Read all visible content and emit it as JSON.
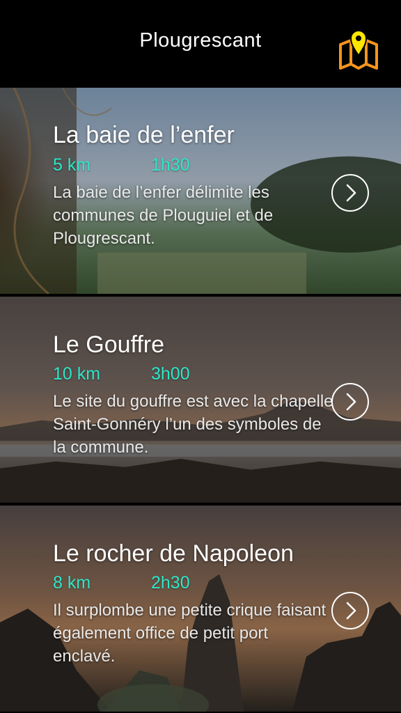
{
  "status_bar": {
    "battery_color": "#4cd964"
  },
  "header": {
    "title": "Plougrescant",
    "map_icon": "map-pin-icon",
    "map_icon_color": "#f7941d",
    "map_pin_color": "#ffe600"
  },
  "accent_color": "#2ee6c9",
  "walks": [
    {
      "title": "La baie de l’enfer",
      "distance": "5 km",
      "duration": "1h30",
      "description": "La baie de l’enfer délimite les communes de Plouguiel et de Plougrescant.",
      "action_icon": "chevron-right-icon"
    },
    {
      "title": "Le Gouffre",
      "distance": "10 km",
      "duration": "3h00",
      "description": "Le site du gouffre est avec la chapelle Saint-Gonnéry l’un des symboles de la commune.",
      "action_icon": "chevron-right-icon"
    },
    {
      "title": "Le rocher de Napoleon",
      "distance": "8 km",
      "duration": "2h30",
      "description": "Il surplombe une petite crique faisant également office de petit port enclavé.",
      "action_icon": "chevron-right-icon"
    }
  ]
}
